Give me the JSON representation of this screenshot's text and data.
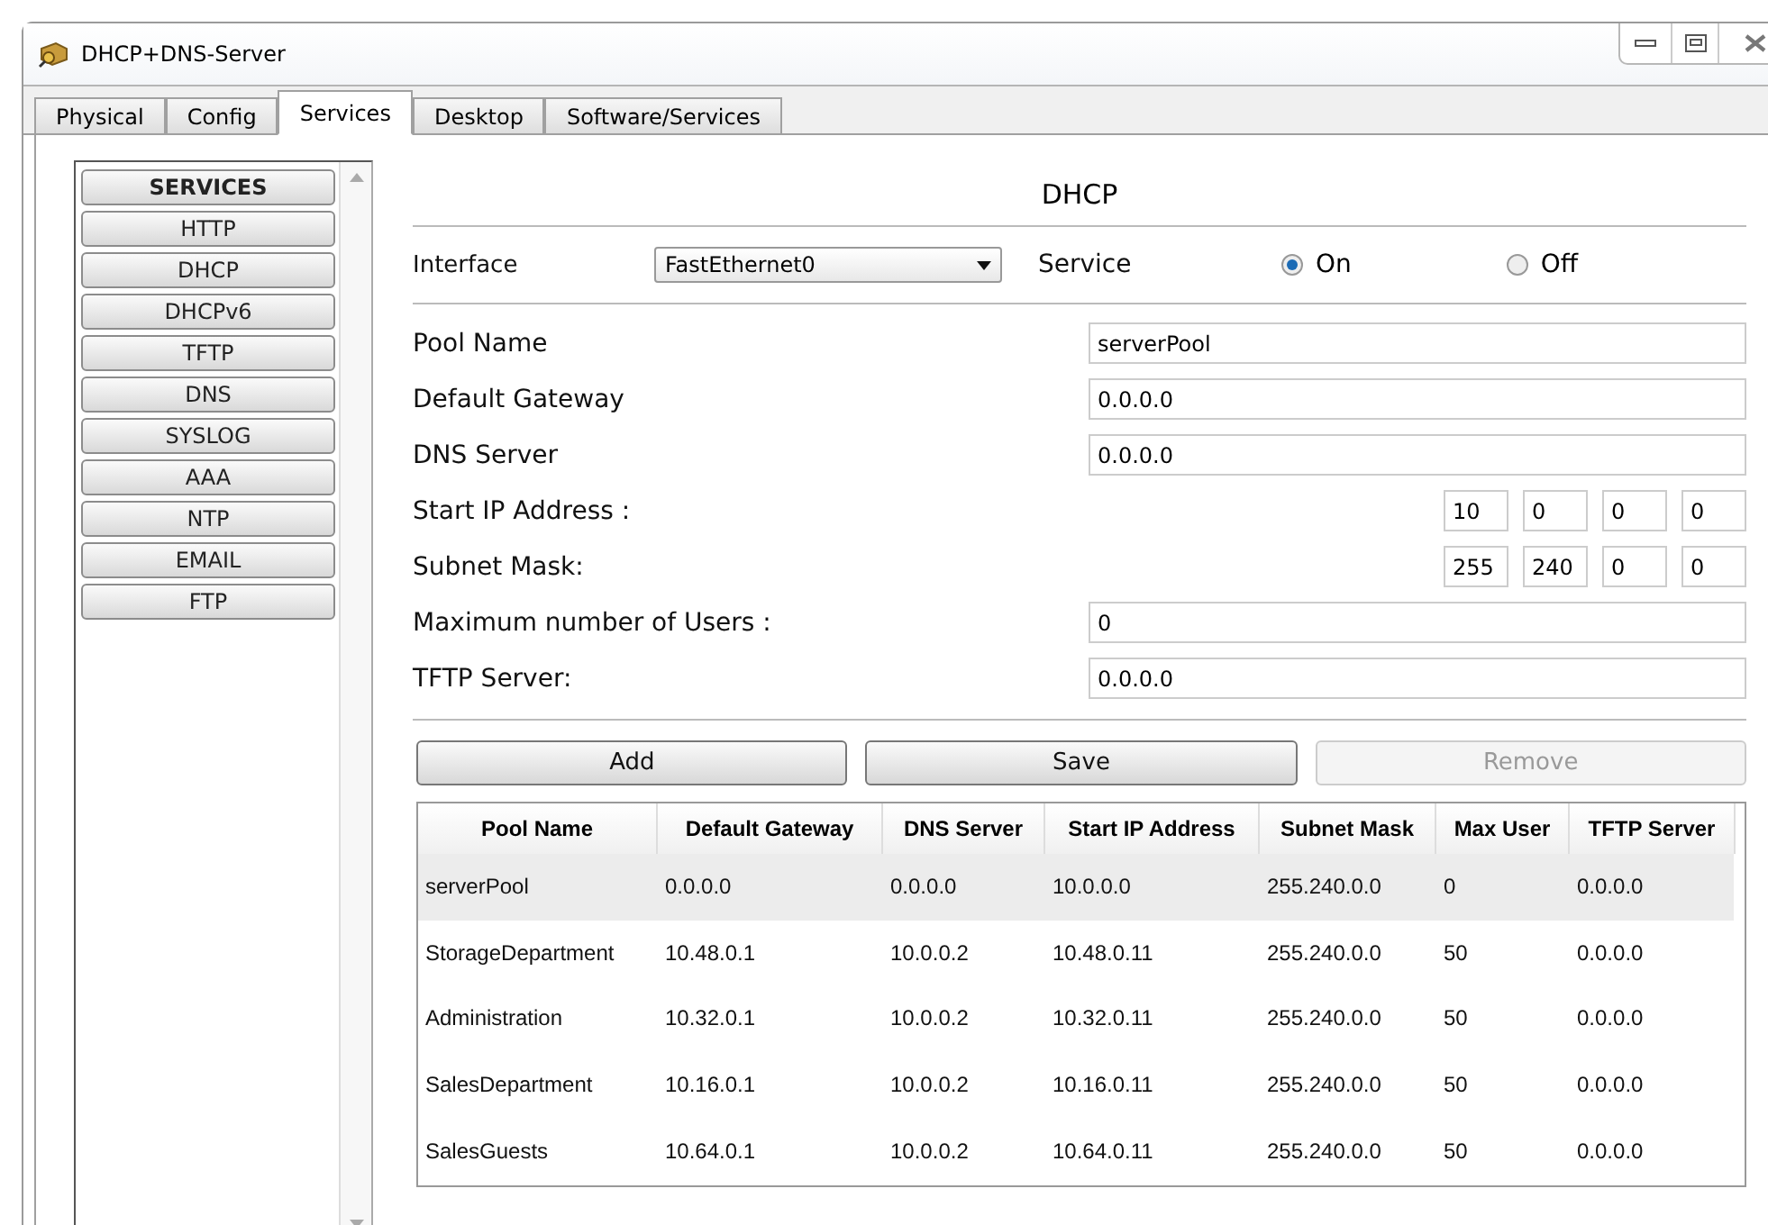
{
  "window": {
    "title": "DHCP+DNS-Server"
  },
  "tabs": [
    {
      "label": "Physical",
      "selected": false
    },
    {
      "label": "Config",
      "selected": false
    },
    {
      "label": "Services",
      "selected": true
    },
    {
      "label": "Desktop",
      "selected": false
    },
    {
      "label": "Software/Services",
      "selected": false
    }
  ],
  "sidebar": {
    "header": "SERVICES",
    "items": [
      {
        "label": "HTTP"
      },
      {
        "label": "DHCP"
      },
      {
        "label": "DHCPv6"
      },
      {
        "label": "TFTP"
      },
      {
        "label": "DNS"
      },
      {
        "label": "SYSLOG"
      },
      {
        "label": "AAA"
      },
      {
        "label": "NTP"
      },
      {
        "label": "EMAIL"
      },
      {
        "label": "FTP"
      }
    ]
  },
  "panel_title": "DHCP",
  "interface": {
    "label": "Interface",
    "value": "FastEthernet0"
  },
  "service": {
    "label": "Service",
    "options": [
      {
        "label": "On",
        "selected": true
      },
      {
        "label": "Off",
        "selected": false
      }
    ]
  },
  "fields": [
    {
      "kind": "text",
      "label": "Pool Name",
      "value": "serverPool"
    },
    {
      "kind": "text",
      "label": "Default Gateway",
      "value": "0.0.0.0"
    },
    {
      "kind": "text",
      "label": "DNS Server",
      "value": "0.0.0.0"
    },
    {
      "kind": "octets",
      "label": "Start IP Address :",
      "octets": [
        "10",
        "0",
        "0",
        "0"
      ]
    },
    {
      "kind": "octets",
      "label": "Subnet Mask:",
      "octets": [
        "255",
        "240",
        "0",
        "0"
      ]
    },
    {
      "kind": "text",
      "label": "Maximum number of Users :",
      "value": "0"
    },
    {
      "kind": "text",
      "label": "TFTP Server:",
      "value": "0.0.0.0"
    }
  ],
  "buttons": [
    {
      "label": "Add",
      "disabled": false
    },
    {
      "label": "Save",
      "disabled": false
    },
    {
      "label": "Remove",
      "disabled": true
    }
  ],
  "table": {
    "columns": [
      "Pool Name",
      "Default Gateway",
      "DNS Server",
      "Start IP Address",
      "Subnet Mask",
      "Max User",
      "TFTP Server"
    ],
    "rows": [
      {
        "selected": true,
        "cells": [
          "serverPool",
          "0.0.0.0",
          "0.0.0.0",
          "10.0.0.0",
          "255.240.0.0",
          "0",
          "0.0.0.0"
        ]
      },
      {
        "selected": false,
        "cells": [
          "StorageDepartment",
          "10.48.0.1",
          "10.0.0.2",
          "10.48.0.11",
          "255.240.0.0",
          "50",
          "0.0.0.0"
        ]
      },
      {
        "selected": false,
        "cells": [
          "Administration",
          "10.32.0.1",
          "10.0.0.2",
          "10.32.0.11",
          "255.240.0.0",
          "50",
          "0.0.0.0"
        ]
      },
      {
        "selected": false,
        "cells": [
          "SalesDepartment",
          "10.16.0.1",
          "10.0.0.2",
          "10.16.0.11",
          "255.240.0.0",
          "50",
          "0.0.0.0"
        ]
      },
      {
        "selected": false,
        "cells": [
          "SalesGuests",
          "10.64.0.1",
          "10.0.0.2",
          "10.64.0.11",
          "255.240.0.0",
          "50",
          "0.0.0.0"
        ]
      }
    ]
  }
}
